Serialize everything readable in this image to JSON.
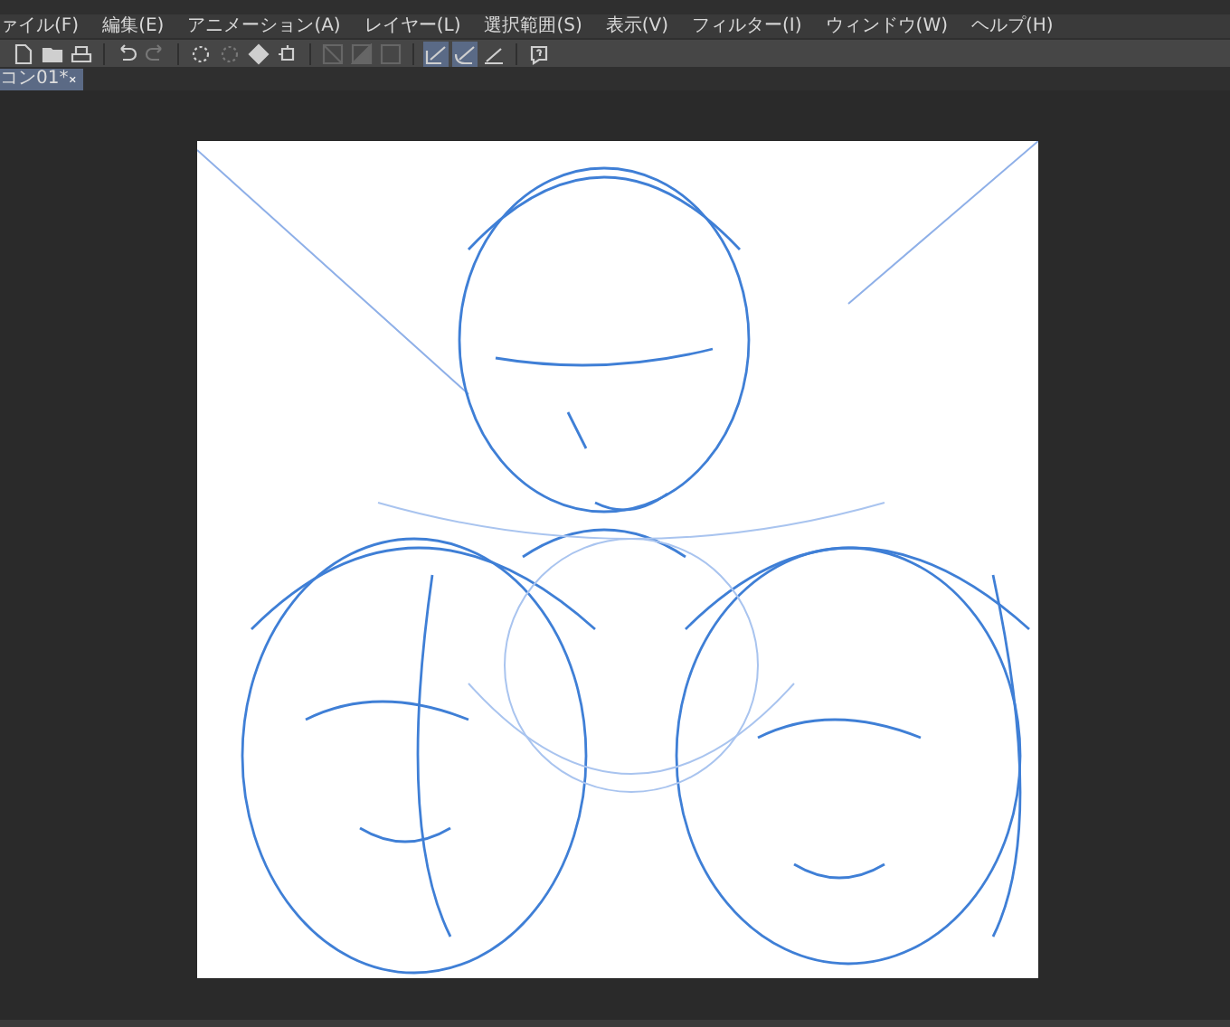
{
  "menu": [
    "ァイル(F)",
    "編集(E)",
    "アニメーション(A)",
    "レイヤー(L)",
    "選択範囲(S)",
    "表示(V)",
    "フィルター(I)",
    "ウィンドウ(W)",
    "ヘルプ(H)"
  ],
  "toolbar": {
    "buttons": [
      {
        "kind": "new-page",
        "selected": false
      },
      {
        "kind": "folder",
        "selected": false
      },
      {
        "kind": "print",
        "selected": false
      },
      {
        "kind": "sep"
      },
      {
        "kind": "undo",
        "selected": false
      },
      {
        "kind": "redo",
        "selected": false
      },
      {
        "kind": "sep"
      },
      {
        "kind": "sun",
        "selected": false
      },
      {
        "kind": "sun-dim",
        "selected": false
      },
      {
        "kind": "fill",
        "selected": false
      },
      {
        "kind": "transform",
        "selected": false
      },
      {
        "kind": "sep"
      },
      {
        "kind": "slash",
        "selected": false
      },
      {
        "kind": "half",
        "selected": false
      },
      {
        "kind": "square",
        "selected": false
      },
      {
        "kind": "sep"
      },
      {
        "kind": "pen-check",
        "selected": true
      },
      {
        "kind": "pen-curve",
        "selected": true
      },
      {
        "kind": "ruler",
        "selected": false
      },
      {
        "kind": "sep"
      },
      {
        "kind": "help",
        "selected": false
      }
    ]
  },
  "tab": {
    "label": "コン01*",
    "selected": true
  }
}
